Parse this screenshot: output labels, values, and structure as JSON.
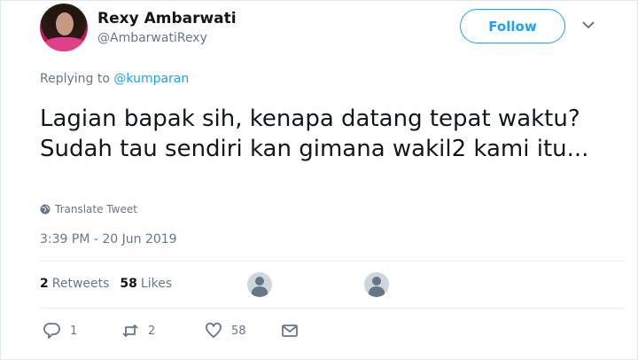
{
  "author": {
    "name": "Rexy Ambarwati",
    "handle": "@AmbarwatiRexy"
  },
  "follow_label": "Follow",
  "replying": {
    "prefix": "Replying to ",
    "to": "@kumparan"
  },
  "tweet_text": "Lagian bapak sih, kenapa datang tepat waktu? Sudah tau sendiri kan gimana wakil2 kami itu...",
  "translate_label": "Translate Tweet",
  "timestamp": "3:39 PM - 20 Jun 2019",
  "stats": {
    "retweets_count": "2",
    "retweets_label": "Retweets",
    "likes_count": "58",
    "likes_label": "Likes"
  },
  "actions": {
    "reply_count": "1",
    "retweet_count": "2",
    "like_count": "58"
  },
  "icons": [
    "chevron-down-icon",
    "globe-icon",
    "reply-icon",
    "retweet-icon",
    "heart-icon",
    "message-icon"
  ],
  "colors": {
    "accent": "#1da1f2",
    "secondary_text": "#657786",
    "primary_text": "#14171a"
  }
}
